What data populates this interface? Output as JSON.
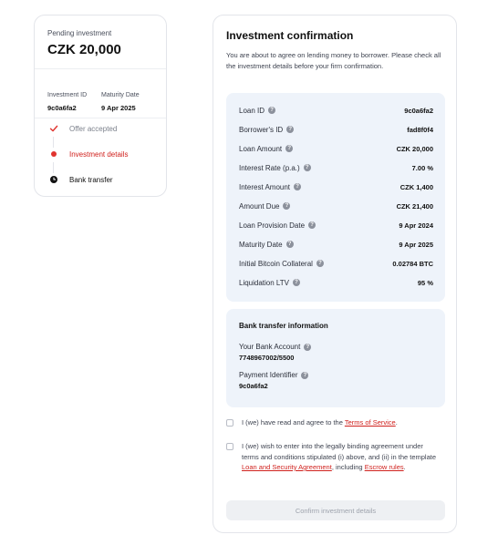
{
  "left": {
    "pending_label": "Pending investment",
    "amount": "CZK 20,000",
    "investment_id_label": "Investment ID",
    "investment_id": "9c0a6fa2",
    "maturity_label": "Maturity Date",
    "maturity_date": "9 Apr 2025",
    "steps": [
      {
        "label": "Offer accepted",
        "state": "done"
      },
      {
        "label": "Investment details",
        "state": "current"
      },
      {
        "label": "Bank transfer",
        "state": "upcoming"
      }
    ]
  },
  "confirmation": {
    "title": "Investment confirmation",
    "intro": "You are about to agree on lending money to borrower. Please check all the investment details before your firm confirmation.",
    "details": [
      {
        "label": "Loan ID",
        "value": "9c0a6fa2"
      },
      {
        "label": "Borrower's ID",
        "value": "fad8f0f4"
      },
      {
        "label": "Loan Amount",
        "value": "CZK 20,000"
      },
      {
        "label": "Interest Rate (p.a.)",
        "value": "7.00 %"
      },
      {
        "label": "Interest Amount",
        "value": "CZK 1,400"
      },
      {
        "label": "Amount Due",
        "value": "CZK 21,400"
      },
      {
        "label": "Loan Provision Date",
        "value": "9 Apr 2024"
      },
      {
        "label": "Maturity Date",
        "value": "9 Apr 2025"
      },
      {
        "label": "Initial Bitcoin Collateral",
        "value": "0.02784 BTC"
      },
      {
        "label": "Liquidation LTV",
        "value": "95 %"
      }
    ],
    "bank": {
      "heading": "Bank transfer information",
      "account_label": "Your Bank Account",
      "account_value": "7748967002/5500",
      "payment_label": "Payment Identifier",
      "payment_value": "9c0a6fa2"
    },
    "terms": {
      "text_before": "I (we) have read and agree to the ",
      "link": "Terms of Service",
      "text_after": "."
    },
    "agreement": {
      "text1": "I (we) wish to enter into the legally binding agreement under terms and conditions stipulated (i) above, and (ii) in the template ",
      "link1": "Loan and Security Agreement",
      "text2": ", including ",
      "link2": "Escrow rules",
      "text3": "."
    },
    "confirm_label": "Confirm investment details"
  },
  "colors": {
    "accent_red": "#d0211d",
    "panel_bg": "#eef3fa",
    "success_red": "#e0342f"
  }
}
